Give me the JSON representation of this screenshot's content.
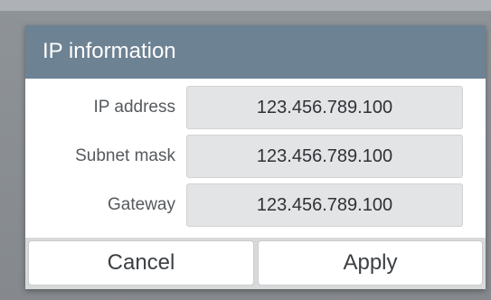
{
  "dialog": {
    "title": "IP information",
    "fields": [
      {
        "label": "IP address",
        "value": "123.456.789.100"
      },
      {
        "label": "Subnet mask",
        "value": "123.456.789.100"
      },
      {
        "label": "Gateway",
        "value": "123.456.789.100"
      }
    ],
    "buttons": {
      "cancel": "Cancel",
      "apply": "Apply"
    }
  },
  "colors": {
    "header": "#6d8293",
    "field_bg": "#e3e4e5",
    "button_bar": "#d7d9db"
  }
}
